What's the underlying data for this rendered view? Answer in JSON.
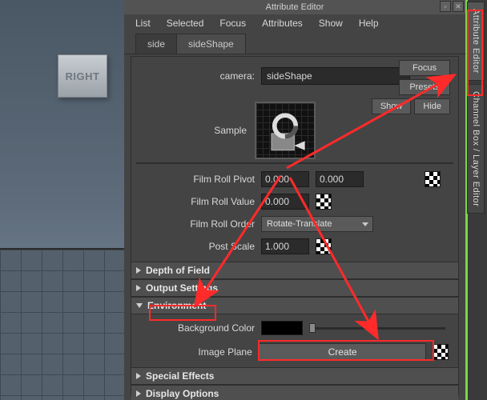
{
  "title": "Attribute Editor",
  "menu": [
    "List",
    "Selected",
    "Focus",
    "Attributes",
    "Show",
    "Help"
  ],
  "tabs": [
    {
      "label": "side",
      "active": false
    },
    {
      "label": "sideShape",
      "active": true
    }
  ],
  "camera": {
    "label": "camera:",
    "value": "sideShape"
  },
  "rightButtons": {
    "focus": "Focus",
    "presets": "Presets",
    "show": "Show",
    "hide": "Hide"
  },
  "sample": {
    "label": "Sample"
  },
  "filmRoll": {
    "pivotLabel": "Film Roll Pivot",
    "pivotX": "0.000",
    "pivotY": "0.000",
    "valueLabel": "Film Roll Value",
    "value": "0.000",
    "orderLabel": "Film Roll Order",
    "orderValue": "Rotate-Translate",
    "postScaleLabel": "Post Scale",
    "postScale": "1.000"
  },
  "sections": {
    "depthOfField": "Depth of Field",
    "outputSettings": "Output Settings",
    "environment": "Environment",
    "specialEffects": "Special Effects",
    "displayOptions": "Display Options"
  },
  "environment": {
    "bgLabel": "Background Color",
    "imagePlaneLabel": "Image Plane",
    "createLabel": "Create"
  },
  "sideTabs": {
    "attributeEditor": "Attribute Editor",
    "channelBox": "Channel Box / Layer Editor"
  },
  "viewport": {
    "cubeLabel": "RIGHT"
  }
}
